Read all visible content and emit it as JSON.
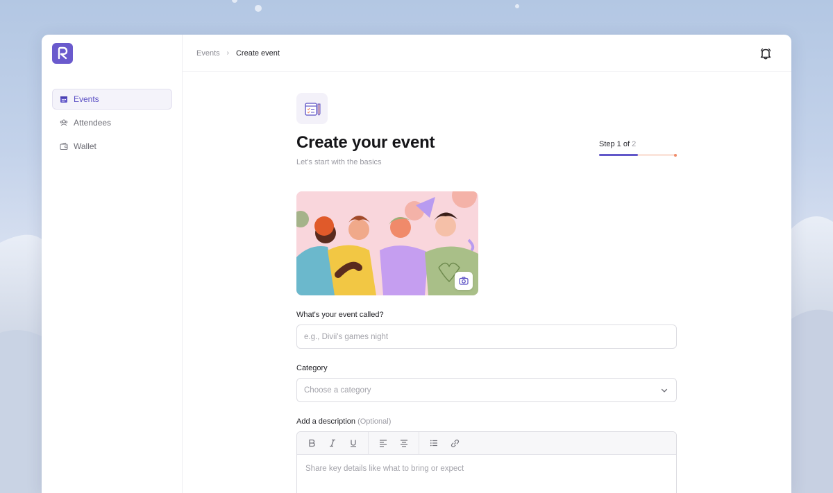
{
  "breadcrumb": {
    "parent": "Events",
    "separator": "›",
    "current": "Create event"
  },
  "sidebar": {
    "items": [
      {
        "label": "Events",
        "icon": "calendar-icon",
        "active": true
      },
      {
        "label": "Attendees",
        "icon": "people-icon",
        "active": false
      },
      {
        "label": "Wallet",
        "icon": "wallet-icon",
        "active": false
      }
    ]
  },
  "header": {
    "title": "Create your event",
    "subtitle": "Let's start with the basics"
  },
  "step": {
    "prefix": "Step 1 of",
    "total": "2",
    "progress": 0.5
  },
  "form": {
    "name_label": "What's your event called?",
    "name_placeholder": "e.g., Divii's games night",
    "category_label": "Category",
    "category_placeholder": "Choose a category",
    "description_label": "Add a description",
    "description_optional": "(Optional)",
    "description_placeholder": "Share key details like what to bring or expect"
  },
  "colors": {
    "accent": "#6157c9",
    "progress_track": "#fbe5dc",
    "progress_end": "#f08c6a"
  }
}
